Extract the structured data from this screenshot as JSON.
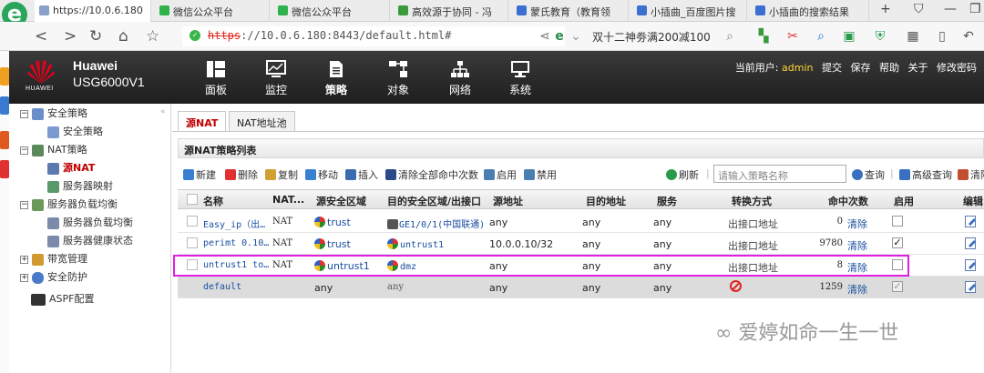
{
  "browser": {
    "tabs": [
      {
        "label": "https://10.0.6.180",
        "color": "#8aa0c8",
        "active": true
      },
      {
        "label": "微信公众平台",
        "color": "#2fb24c"
      },
      {
        "label": "微信公众平台",
        "color": "#2fb24c"
      },
      {
        "label": "高效源于协同 - 冯",
        "color": "#3a9a3a"
      },
      {
        "label": "蒙氏教育（教育领",
        "color": "#3a70d0"
      },
      {
        "label": "小插曲_百度图片搜",
        "color": "#3a70d0"
      },
      {
        "label": "小插曲的搜索结果",
        "color": "#3a70d0"
      }
    ],
    "url_scheme": "https",
    "url_rest": "://10.0.6.180:8443/default.html#",
    "search_text": "双十二神劵满200减100"
  },
  "app": {
    "brand_name": "Huawei",
    "brand_model": "USG6000V1",
    "logo_text": "HUAWEI",
    "menu": [
      "面板",
      "监控",
      "策略",
      "对象",
      "网络",
      "系统"
    ],
    "user_label": "当前用户:",
    "user_name": "admin",
    "user_links": [
      "提交",
      "保存",
      "帮助",
      "关于",
      "修改密码"
    ]
  },
  "sidebar": {
    "items": [
      {
        "label": "安全策略",
        "toggle": "−",
        "level": 0
      },
      {
        "label": "安全策略",
        "level": 1
      },
      {
        "label": "NAT策略",
        "toggle": "−",
        "level": 0
      },
      {
        "label": "源NAT",
        "level": 1,
        "current": true
      },
      {
        "label": "服务器映射",
        "level": 1
      },
      {
        "label": "服务器负载均衡",
        "toggle": "−",
        "level": 0
      },
      {
        "label": "服务器负载均衡",
        "level": 1
      },
      {
        "label": "服务器健康状态",
        "level": 1
      },
      {
        "label": "带宽管理",
        "toggle": "+",
        "level": 0
      },
      {
        "label": "安全防护",
        "toggle": "+",
        "level": 0
      },
      {
        "label": "ASPF配置",
        "level": 0
      }
    ]
  },
  "content": {
    "tabs": [
      "源NAT",
      "NAT地址池"
    ],
    "panel_title": "源NAT策略列表",
    "toolbar": [
      "新建",
      "删除",
      "复制",
      "移动",
      "插入",
      "清除全部命中次数",
      "启用",
      "禁用"
    ],
    "refresh": "刷新",
    "filter_placeholder": "请输入策略名称",
    "query": "查询",
    "adv_query": "高级查询",
    "clear_label": "清除"
  },
  "table": {
    "headers": [
      "名称",
      "NAT...",
      "源安全区域",
      "目的安全区域/出接口",
      "源地址",
      "目的地址",
      "服务",
      "转换方式",
      "命中次数",
      "启用",
      "编辑"
    ],
    "rows": [
      {
        "name": "Easy_ip（出…",
        "nat": "NAT",
        "src_zone": "trust",
        "dst": "GE1/0/1(中国联通)",
        "src_addr": "any",
        "dst_addr": "any",
        "service": "any",
        "method": "出接口地址",
        "hits": "0",
        "clear": "清除",
        "enabled": false
      },
      {
        "name": "perimt 0.10…",
        "nat": "NAT",
        "src_zone": "trust",
        "dst": "untrust1",
        "src_addr": "10.0.0.10/32",
        "dst_addr": "any",
        "service": "any",
        "method": "出接口地址",
        "hits": "9780",
        "clear": "清除",
        "enabled": true
      },
      {
        "name": "untrust1 to…",
        "nat": "NAT",
        "src_zone": "untrust1",
        "dst": "dmz",
        "src_addr": "any",
        "dst_addr": "any",
        "service": "any",
        "method": "出接口地址",
        "hits": "8",
        "clear": "清除",
        "enabled": false
      },
      {
        "name": "default",
        "nat": "",
        "src_zone": "any",
        "dst": "any",
        "src_addr": "any",
        "dst_addr": "any",
        "service": "any",
        "method": "",
        "hits": "1259",
        "clear": "清除",
        "enabled": true,
        "is_default": true
      }
    ]
  },
  "watermark": "爱婷如命一生一世"
}
